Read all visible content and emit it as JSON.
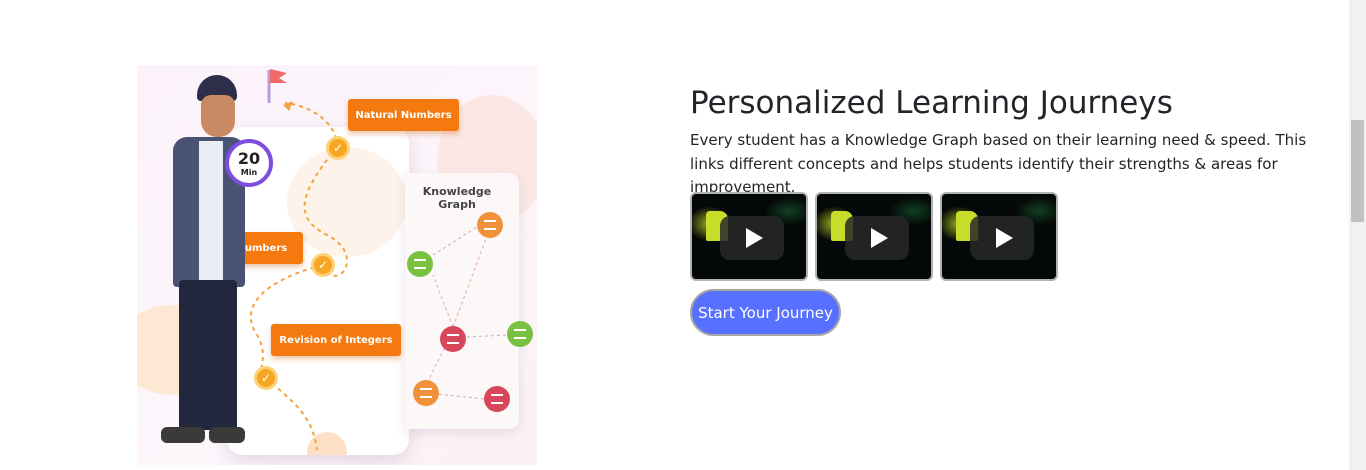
{
  "hero_illustration": {
    "timer_value": "20",
    "timer_unit": "Min",
    "tags": {
      "natural": "Natural Numbers",
      "whole": "Whole Numbers",
      "revision": "Revision of Integers"
    },
    "graph_title": "Knowledge Graph",
    "colors": {
      "tag": "#f4790f",
      "node_green": "#7ac142",
      "node_red": "#d9465b",
      "node_orange": "#f0913b"
    }
  },
  "section": {
    "title": "Personalized Learning Journeys",
    "description": "Every student has a Knowledge Graph based on their learning need & speed. This links different concepts and helps students identify their strengths & areas for improvement.",
    "videos": [
      {
        "icon": "play-icon"
      },
      {
        "icon": "play-icon"
      },
      {
        "icon": "play-icon"
      }
    ],
    "cta_label": "Start Your Journey",
    "cta_color": "#5770ff"
  }
}
